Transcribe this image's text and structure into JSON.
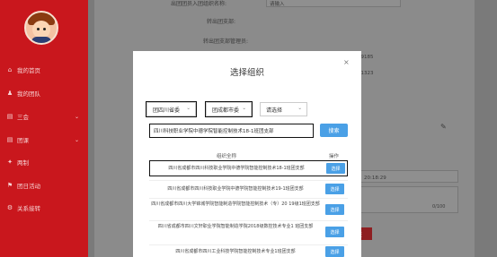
{
  "sidebar": {
    "items": [
      {
        "icon": "home-icon",
        "glyph": "⌂",
        "label": "我的首页",
        "has_chevron": false
      },
      {
        "icon": "users-icon",
        "glyph": "♟",
        "label": "我的团队",
        "has_chevron": false
      },
      {
        "icon": "folder-icon",
        "glyph": "▤",
        "label": "三会",
        "has_chevron": true
      },
      {
        "icon": "folder-icon",
        "glyph": "▤",
        "label": "团课",
        "has_chevron": true
      },
      {
        "icon": "gear-icon",
        "glyph": "✦",
        "label": "两制",
        "has_chevron": false
      },
      {
        "icon": "flag-icon",
        "glyph": "⚑",
        "label": "团日活动",
        "has_chevron": false
      },
      {
        "icon": "link-icon",
        "glyph": "⚙",
        "label": "关系接转",
        "has_chevron": false
      }
    ]
  },
  "background_form": {
    "top_label": "出团团员入团组织名称:",
    "top_value": "请输入",
    "transfer_org_label": "转出团支部:",
    "transfer_admin_label": "转出团支部管理员:",
    "phone_1": "29185",
    "phone_2": "31323",
    "time_value": "20:18:29",
    "counter": "0/100",
    "submit_label": "交"
  },
  "modal": {
    "title": "选择组织",
    "close_glyph": "×",
    "select_1": "团四川省委",
    "select_2": "团成都市委",
    "select_3": "请选择",
    "search_value": "四川科技职业学院中德学院智能控制技术18-1班团支部",
    "search_button": "搜索",
    "col_org": "组织全称",
    "col_action": "操作",
    "rows": [
      {
        "name": "四川省成都市四川科技职业学院中德学院智能控制技术18-1班团支部",
        "action": "选择"
      },
      {
        "name": "四川省成都市四川科技职业学院中德学院智能控制技术19-1班团支部",
        "action": "选择"
      },
      {
        "name": "四川省成都市四川大学锦城学院智能制造学院智能控制技术（专）20 19级1班团支部",
        "action": "选择"
      },
      {
        "name": "四川省成都市四川文轩职业学院智能制造学院2018级数控技术专业1 班团支部",
        "action": "选择"
      },
      {
        "name": "四川省成都市四川工业科技学院智能控制技术专业1班团支部",
        "action": "选择"
      }
    ]
  }
}
